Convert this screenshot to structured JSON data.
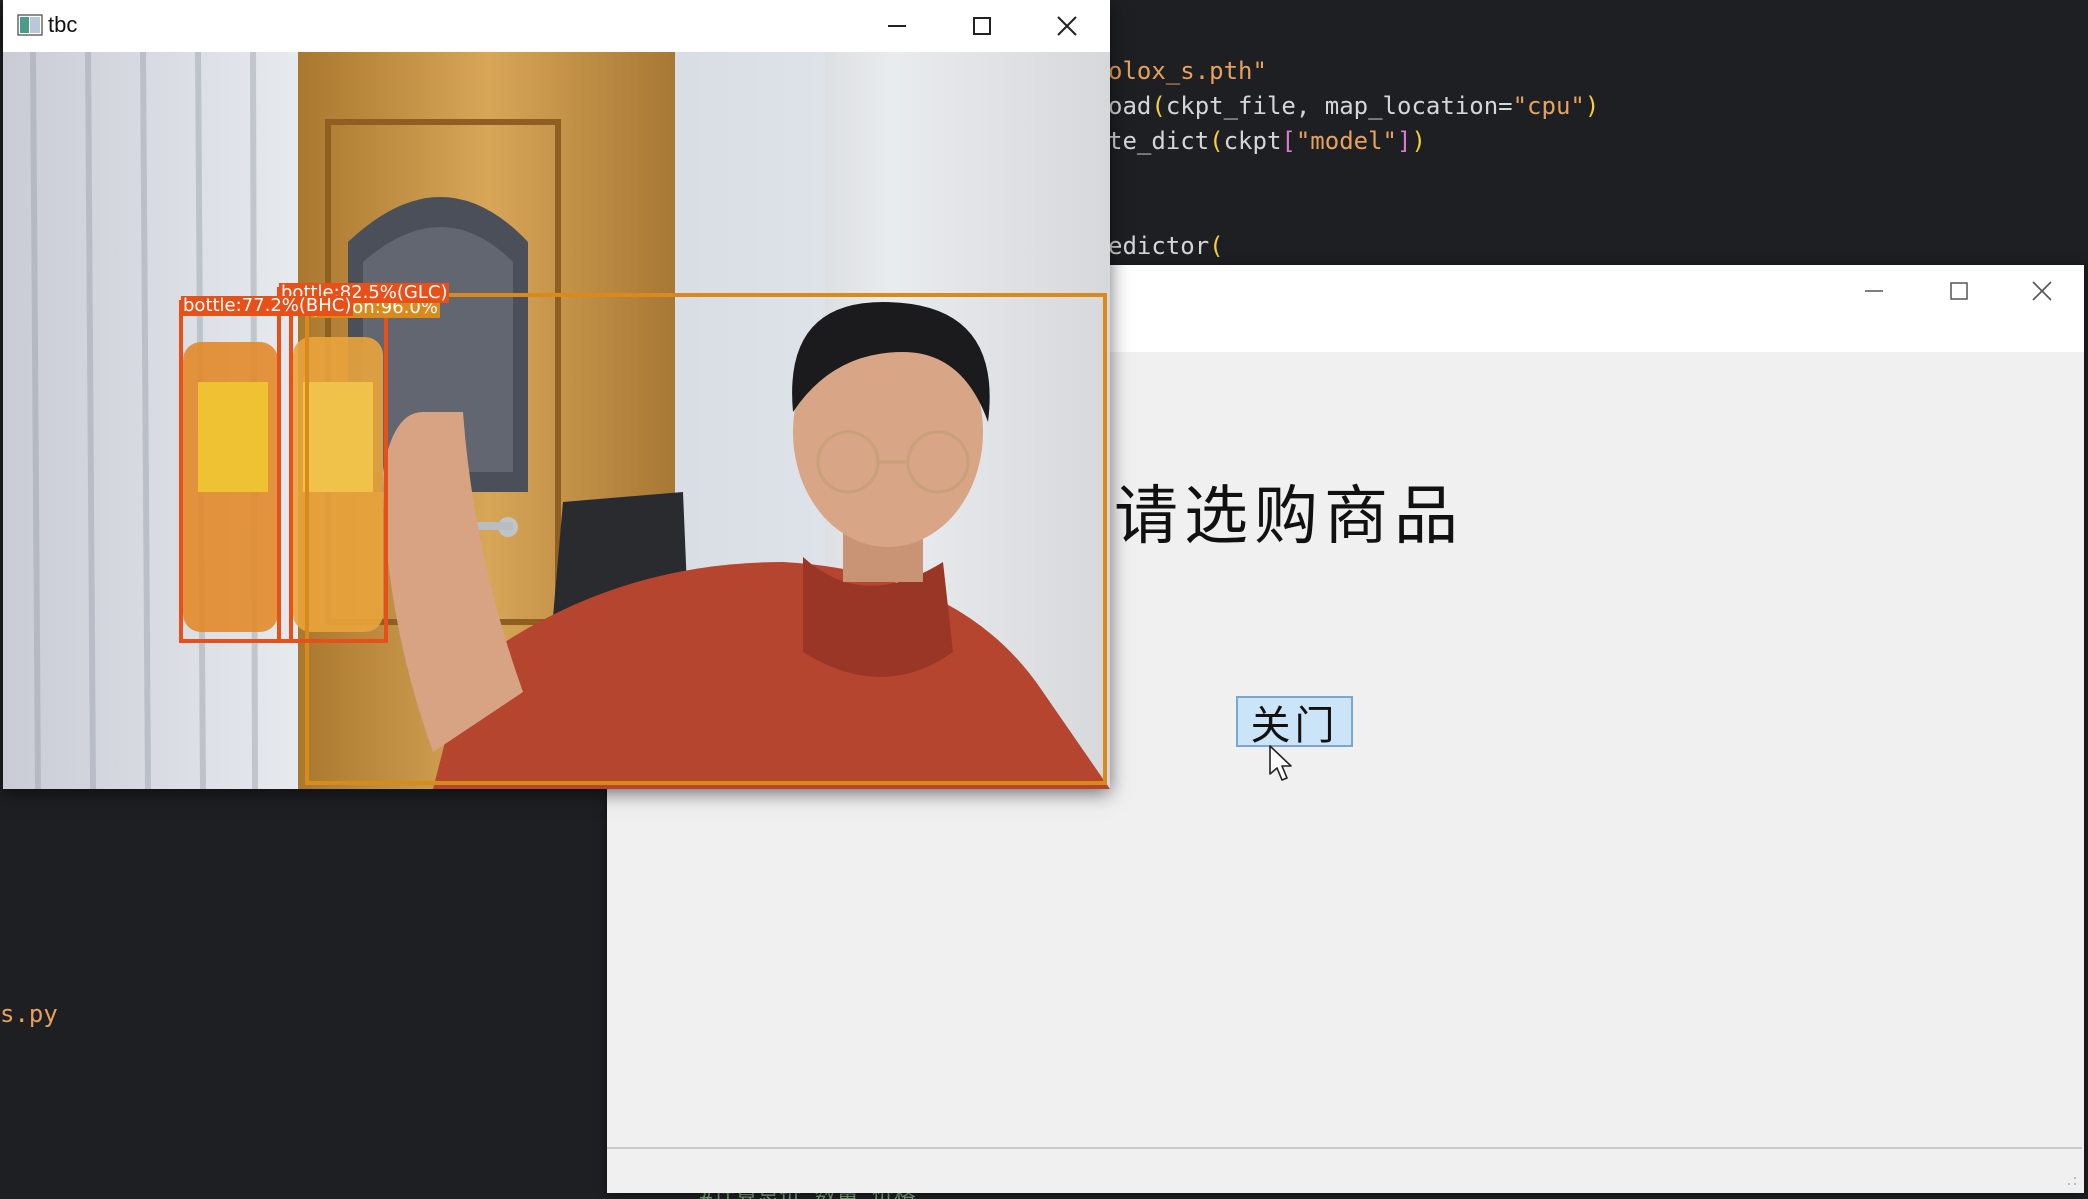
{
  "editor": {
    "lines": [
      {
        "plain": "",
        "str": "olox_s.pth\""
      },
      {
        "plain": "oad",
        "paren_open": "(",
        "mid": "ckpt_file, map_location=",
        "str": "\"cpu\"",
        "paren_close": ")"
      },
      {
        "plain": "te_dict",
        "paren_open": "(",
        "mid": "ckpt",
        "bracket_open": "[",
        "str": "\"model\"",
        "bracket_close": "]",
        "paren_close": ")"
      },
      {
        "plain": "edictor",
        "paren_open": "("
      }
    ],
    "filename": "s.py",
    "bottom_fragment": "#计算总价 数量 价格"
  },
  "camera_window": {
    "title": "tbc",
    "detections": [
      {
        "label": "bottle:77.2%(BHC)",
        "color": "#e8501a"
      },
      {
        "label": "bottle:82.5%(GLC)",
        "color": "#e8501a"
      },
      {
        "label": "person:96.0%",
        "color": "#d98a1a"
      }
    ]
  },
  "app_window": {
    "heading": "请选购商品",
    "close_door_button": "关门"
  },
  "colors": {
    "editor_bg": "#1e1f22",
    "string": "#e8a15c",
    "button_bg": "#cce4f7"
  }
}
